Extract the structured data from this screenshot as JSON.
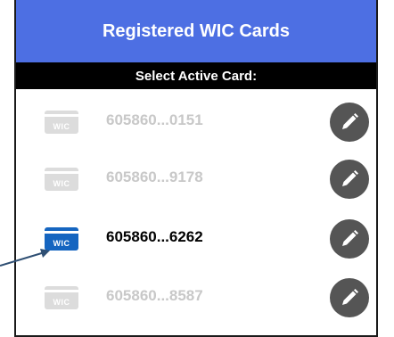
{
  "header": {
    "title": "Registered WIC Cards"
  },
  "subheader": {
    "text": "Select Active Card:"
  },
  "cards": [
    {
      "number": "605860...0151",
      "card_label": "WIC",
      "active": false
    },
    {
      "number": "605860...9178",
      "card_label": "WIC",
      "active": false
    },
    {
      "number": "605860...6262",
      "card_label": "WIC",
      "active": true
    },
    {
      "number": "605860...8587",
      "card_label": "WIC",
      "active": false
    }
  ],
  "icons": {
    "card": "wic-card-icon",
    "edit": "pencil-icon"
  },
  "colors": {
    "header_bg": "#4d6fe3",
    "active_card": "#1565c0",
    "inactive_card": "#dcdcdc",
    "inactive_text": "#c8c8c8",
    "edit_button": "#555555",
    "annotation_arrow": "#2f4f73"
  }
}
